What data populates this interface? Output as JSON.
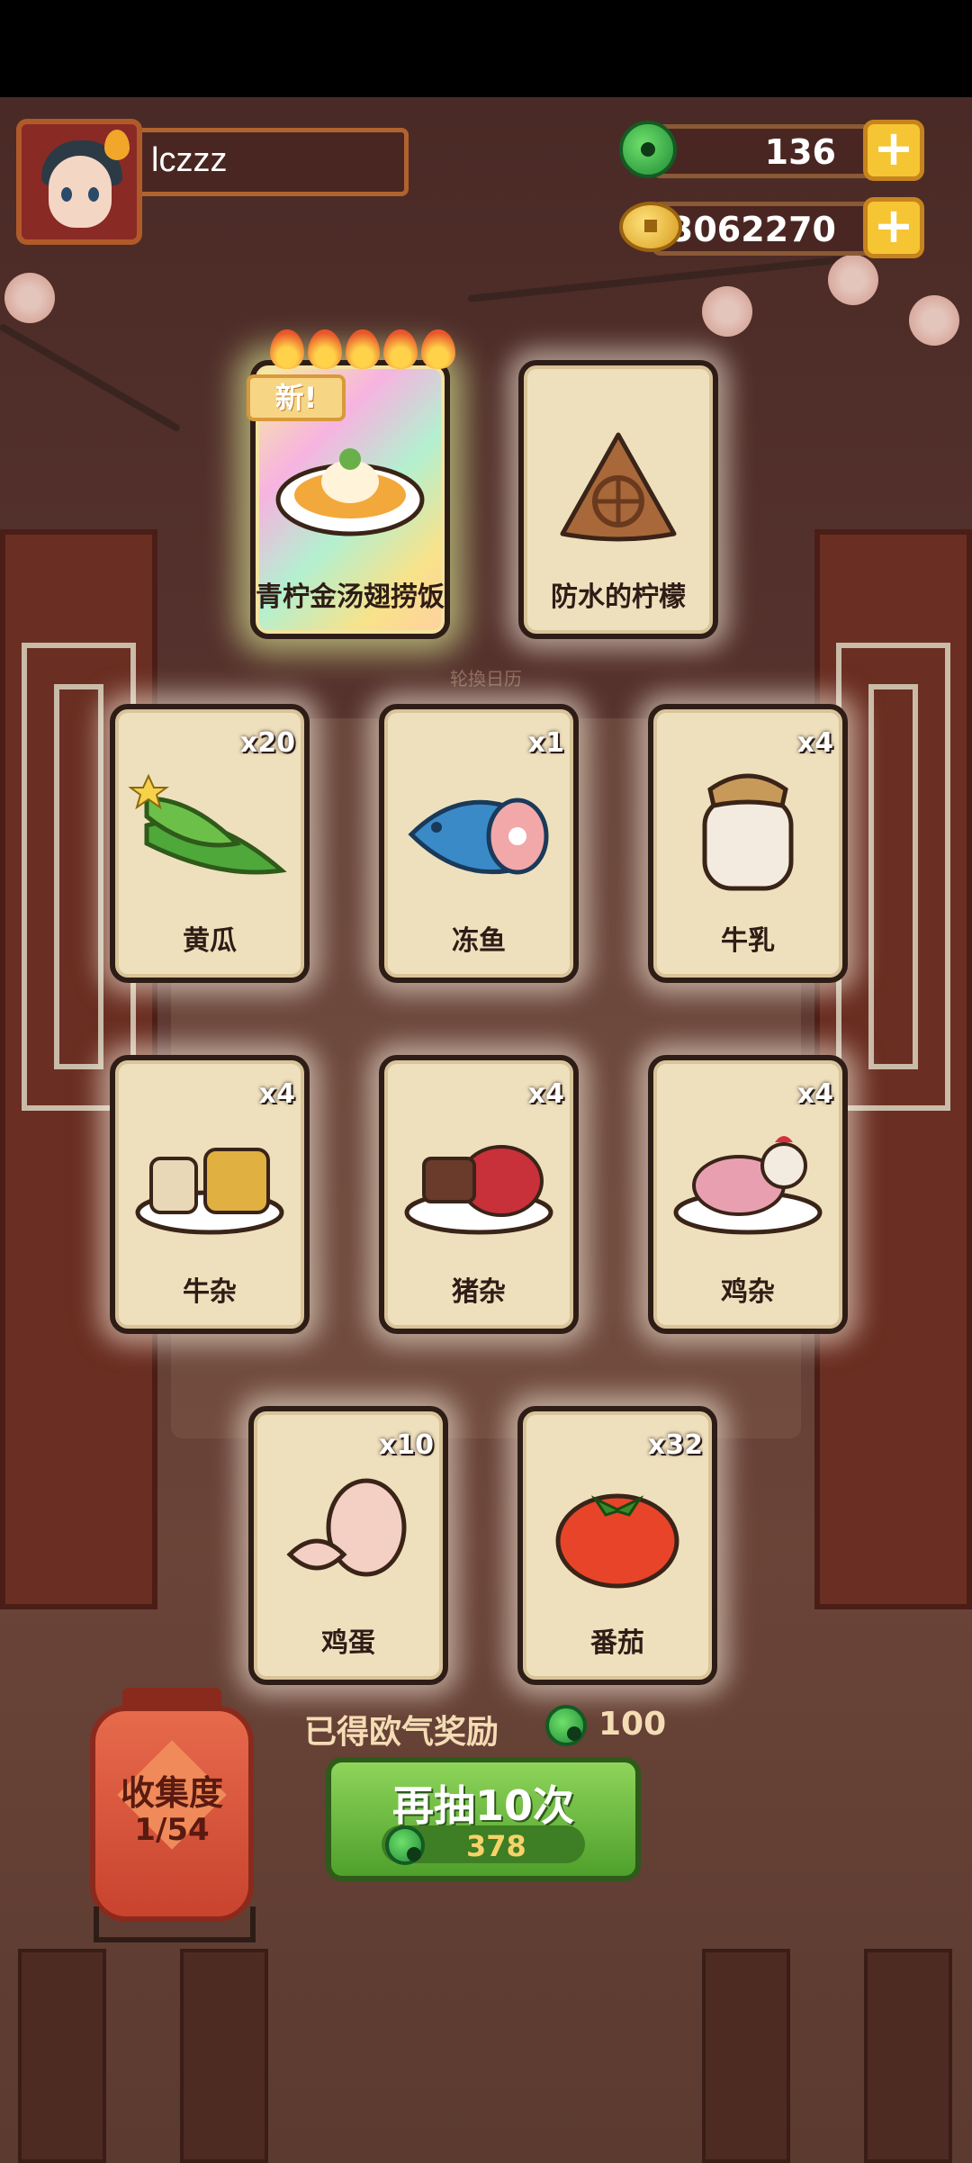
{
  "player": {
    "name": "lczzz"
  },
  "currencies": {
    "jade": "136",
    "coins": "13062270",
    "plus": "+"
  },
  "featured_cards": [
    {
      "label": "青柠金汤翅捞饭",
      "badge": "新!",
      "rare": true
    },
    {
      "label": "防水的柠檬",
      "rare": false
    }
  ],
  "shelf_caption": "轮換日历",
  "cards": [
    {
      "label": "黄瓜",
      "count": "x20"
    },
    {
      "label": "冻鱼",
      "count": "x1"
    },
    {
      "label": "牛乳",
      "count": "x4"
    },
    {
      "label": "牛杂",
      "count": "x4"
    },
    {
      "label": "猪杂",
      "count": "x4"
    },
    {
      "label": "鸡杂",
      "count": "x4"
    },
    {
      "label": "鸡蛋",
      "count": "x10"
    },
    {
      "label": "番茄",
      "count": "x32"
    }
  ],
  "reward": {
    "label": "已得欧气奖励",
    "value": "100"
  },
  "draw_button": {
    "label": "再抽10次",
    "cost": "378"
  },
  "collection": {
    "label": "收集度",
    "progress": "1/54"
  },
  "colors": {
    "accent_green": "#4fa02c",
    "gold": "#f6c534",
    "card_bg": "#efe0bd"
  },
  "icons": [
    "jade-icon",
    "coin-icon",
    "plus-icon",
    "flame-icon",
    "lantern-icon"
  ]
}
